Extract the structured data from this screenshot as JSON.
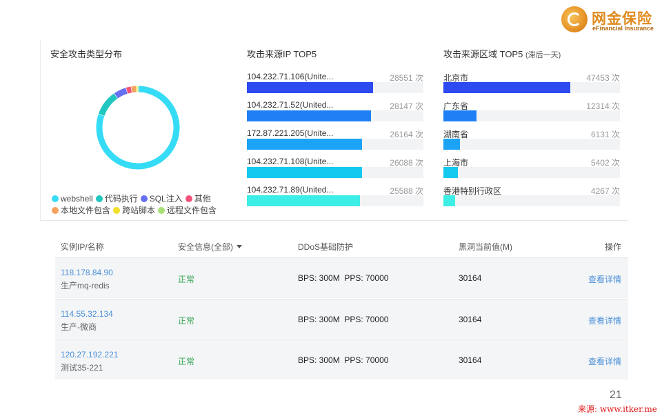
{
  "logo": {
    "cn": "网金保险",
    "en": "eFinancial Insurance"
  },
  "attack_types": {
    "title": "安全攻击类型分布",
    "legend": [
      {
        "label": "webshell",
        "color": "#36dcf5"
      },
      {
        "label": "代码执行",
        "color": "#20c6c0"
      },
      {
        "label": "SQL注入",
        "color": "#6670f0"
      },
      {
        "label": "其他",
        "color": "#f2537a"
      },
      {
        "label": "本地文件包含",
        "color": "#f5a261"
      },
      {
        "label": "跨站脚本",
        "color": "#f2e02a"
      },
      {
        "label": "远程文件包含",
        "color": "#a8e074"
      }
    ],
    "shares": [
      80,
      10,
      5,
      2,
      2,
      0.5,
      0.5
    ]
  },
  "ip_top5": {
    "title": "攻击来源IP TOP5",
    "unit": "次",
    "max": 40000,
    "items": [
      {
        "label": "104.232.71.106(Unite...",
        "count": "28551",
        "value": 28551,
        "color": "#2d49f0"
      },
      {
        "label": "104.232.71.52(United...",
        "count": "28147",
        "value": 28147,
        "color": "#1f7ff5"
      },
      {
        "label": "172.87.221.205(Unite...",
        "count": "26164",
        "value": 26164,
        "color": "#1ca3f5"
      },
      {
        "label": "104.232.71.108(Unite...",
        "count": "26088",
        "value": 26088,
        "color": "#14c9ef"
      },
      {
        "label": "104.232.71.89(United...",
        "count": "25588",
        "value": 25588,
        "color": "#3ceee6"
      }
    ]
  },
  "region_top5": {
    "title": "攻击来源区域 TOP5",
    "subtitle": "(滞后一天)",
    "unit": "次",
    "max": 66000,
    "items": [
      {
        "label": "北京市",
        "count": "47453",
        "value": 47453,
        "color": "#2d49f0"
      },
      {
        "label": "广东省",
        "count": "12314",
        "value": 12314,
        "color": "#1f7ff5"
      },
      {
        "label": "湖南省",
        "count": "6131",
        "value": 6131,
        "color": "#1ca3f5"
      },
      {
        "label": "上海市",
        "count": "5402",
        "value": 5402,
        "color": "#14c9ef"
      },
      {
        "label": "香港特别行政区",
        "count": "4267",
        "value": 4267,
        "color": "#3ceee6"
      }
    ]
  },
  "table": {
    "headers": {
      "instance": "实例IP/名称",
      "security": "安全信息(全部)",
      "ddos": "DDoS基础防护",
      "blackhole": "黑洞当前值(M)",
      "action": "操作"
    },
    "rows": [
      {
        "ip": "118.178.84.90",
        "name": "生产mq-redis",
        "status": "正常",
        "ddos": "BPS: 300M  PPS: 70000",
        "blackhole": "30164",
        "action": "查看详情"
      },
      {
        "ip": "114.55.32.134",
        "name": "生产-微商",
        "status": "正常",
        "ddos": "BPS: 300M  PPS: 70000",
        "blackhole": "30164",
        "action": "查看详情"
      },
      {
        "ip": "120.27.192.221",
        "name": "测试35-221",
        "status": "正常",
        "ddos": "BPS: 300M  PPS: 70000",
        "blackhole": "30164",
        "action": "查看详情"
      }
    ]
  },
  "page_number": "21",
  "source": "来源: www.itker.me"
}
